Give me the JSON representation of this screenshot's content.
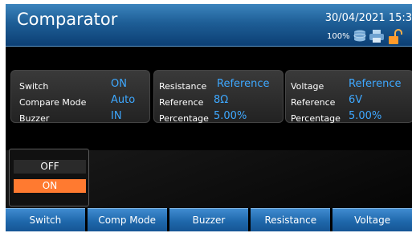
{
  "header": {
    "title": "Comparator",
    "datetime": "30/04/2021 15:3",
    "battery": "100%",
    "icons": [
      "disk-icon",
      "printer-icon",
      "unlock-icon"
    ]
  },
  "switch_panel": {
    "rows": [
      {
        "label": "Switch",
        "value": "ON"
      },
      {
        "label": "Compare Mode",
        "value": "Auto"
      },
      {
        "label": "Buzzer",
        "value": "IN"
      }
    ]
  },
  "resistance_panel": {
    "title_label": "Resistance",
    "title_value": "Reference",
    "rows": [
      {
        "label": "Reference",
        "value": "8Ω"
      },
      {
        "label": "Percentage",
        "value": "5.00%"
      }
    ]
  },
  "voltage_panel": {
    "title_label": "Voltage",
    "title_value": "Reference",
    "rows": [
      {
        "label": "Reference",
        "value": "6V"
      },
      {
        "label": "Percentage",
        "value": "5.00%"
      }
    ]
  },
  "popup": {
    "options": [
      "OFF",
      "ON"
    ],
    "selected": "ON"
  },
  "softkeys": [
    "Switch",
    "Comp Mode",
    "Buzzer",
    "Resistance",
    "Voltage"
  ],
  "colors": {
    "accent_value": "#3ea8ff",
    "selected_option": "#ff7a30",
    "title_bar": "#1e5e96",
    "softkey": "#1e67aa"
  }
}
